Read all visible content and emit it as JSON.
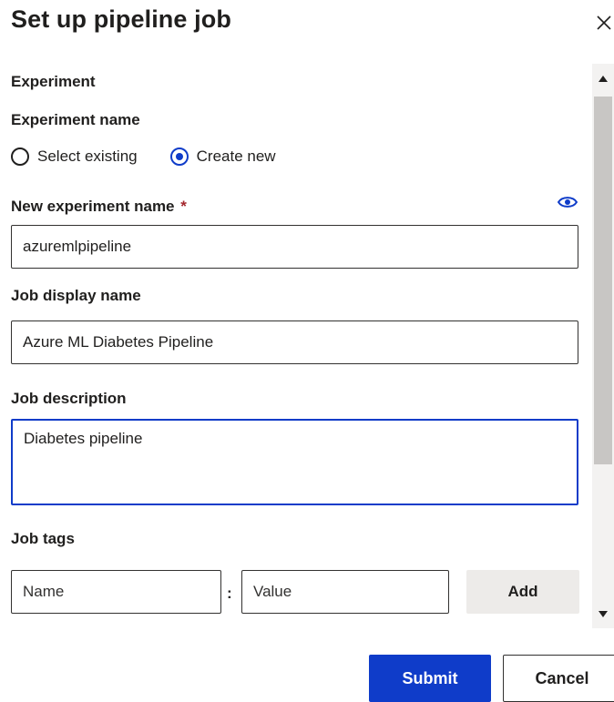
{
  "dialog": {
    "title": "Set up pipeline job"
  },
  "experiment": {
    "section_title": "Experiment",
    "name_label": "Experiment name",
    "options": [
      {
        "label": "Select existing",
        "selected": false
      },
      {
        "label": "Create new",
        "selected": true
      }
    ],
    "new_name_label": "New experiment name",
    "required_marker": "*",
    "new_name_value": "azuremlpipeline"
  },
  "job": {
    "display_name_label": "Job display name",
    "display_name_value": "Azure ML Diabetes Pipeline",
    "description_label": "Job description",
    "description_value": "Diabetes pipeline",
    "tags_label": "Job tags",
    "tag_name_placeholder": "Name",
    "tag_separator": ":",
    "tag_value_placeholder": "Value",
    "add_label": "Add"
  },
  "footer": {
    "submit_label": "Submit",
    "cancel_label": "Cancel"
  },
  "icons": {
    "close": "close-icon",
    "visibility": "eye-icon",
    "scroll_up": "caret-up-icon",
    "scroll_down": "caret-down-icon"
  },
  "colors": {
    "accent": "#0f3cc9",
    "required": "#a4262c",
    "button_secondary_bg": "#edebe9"
  }
}
